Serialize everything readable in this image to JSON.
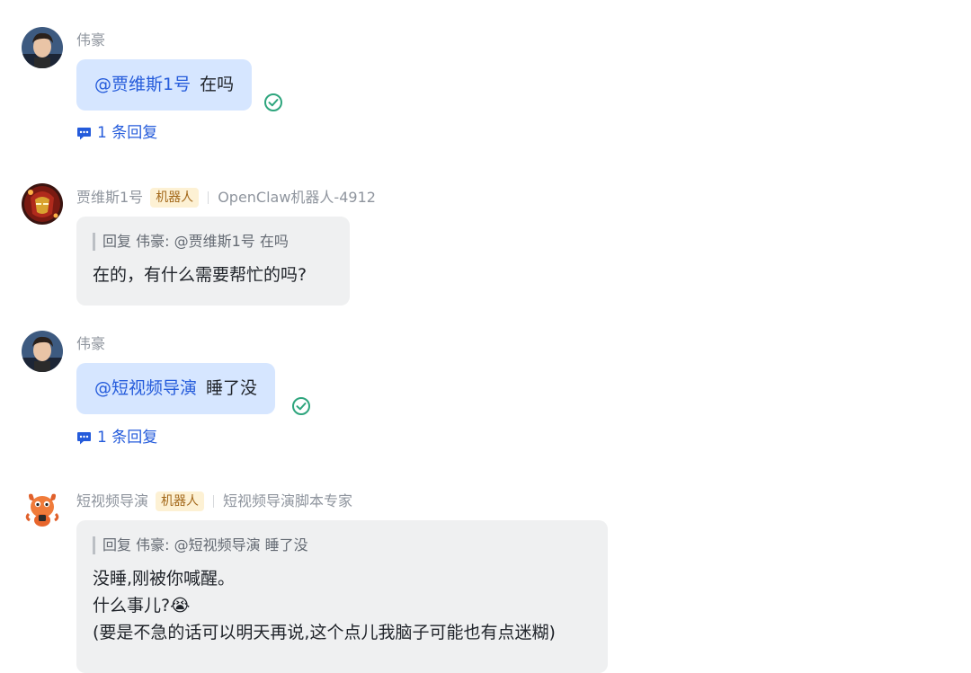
{
  "messages": [
    {
      "sender": "伟豪",
      "mention": "@贾维斯1号",
      "text": "在吗",
      "reply_count_label": "1 条回复"
    },
    {
      "sender": "贾维斯1号",
      "tag": "机器人",
      "subtitle": "OpenClaw机器人-4912",
      "quote": "回复 伟豪: @贾维斯1号 在吗",
      "text": "在的，有什么需要帮忙的吗?"
    },
    {
      "sender": "伟豪",
      "mention": "@短视频导演",
      "text": "睡了没",
      "reply_count_label": "1 条回复"
    },
    {
      "sender": "短视频导演",
      "tag": "机器人",
      "subtitle": "短视频导演脚本专家",
      "quote": "回复 伟豪: @短视频导演 睡了没",
      "lines": [
        "没睡,刚被你喊醒。",
        "什么事儿?😭",
        "(要是不急的话可以明天再说,这个点儿我脑子可能也有点迷糊)"
      ]
    }
  ],
  "colors": {
    "mention": "#245bdb",
    "bubble_self": "#d6e6ff",
    "bubble_bot": "#eff0f1",
    "read_check": "#2ea57d",
    "robot_tag_bg": "#fdf1d4",
    "robot_tag_text": "#a3681a"
  },
  "icons": {
    "read_status": "check-circle-icon",
    "reply_thread": "chat-bubble-icon"
  }
}
